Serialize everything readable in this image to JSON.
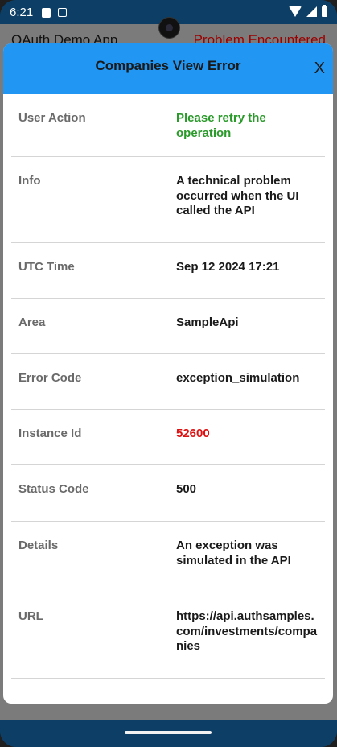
{
  "status_bar": {
    "time": "6:21"
  },
  "app_bar": {
    "title": "OAuth Demo App",
    "status": "Problem Encountered"
  },
  "modal": {
    "title": "Companies View Error",
    "close_label": "X",
    "rows": [
      {
        "label": "User Action",
        "value": "Please retry the operation"
      },
      {
        "label": "Info",
        "value": "A technical problem occurred when the UI called the API"
      },
      {
        "label": "UTC Time",
        "value": "Sep 12 2024 17:21"
      },
      {
        "label": "Area",
        "value": "SampleApi"
      },
      {
        "label": "Error Code",
        "value": "exception_simulation"
      },
      {
        "label": "Instance Id",
        "value": "52600"
      },
      {
        "label": "Status Code",
        "value": "500"
      },
      {
        "label": "Details",
        "value": "An exception was simulated in the API"
      },
      {
        "label": "URL",
        "value": "https://api.authsamples.com/investments/companies"
      }
    ]
  },
  "colors": {
    "header": "#2196f3",
    "user_action_value": "#2a9a2a",
    "instance_id_value": "#dd1111",
    "problem_text": "#9b0000"
  }
}
